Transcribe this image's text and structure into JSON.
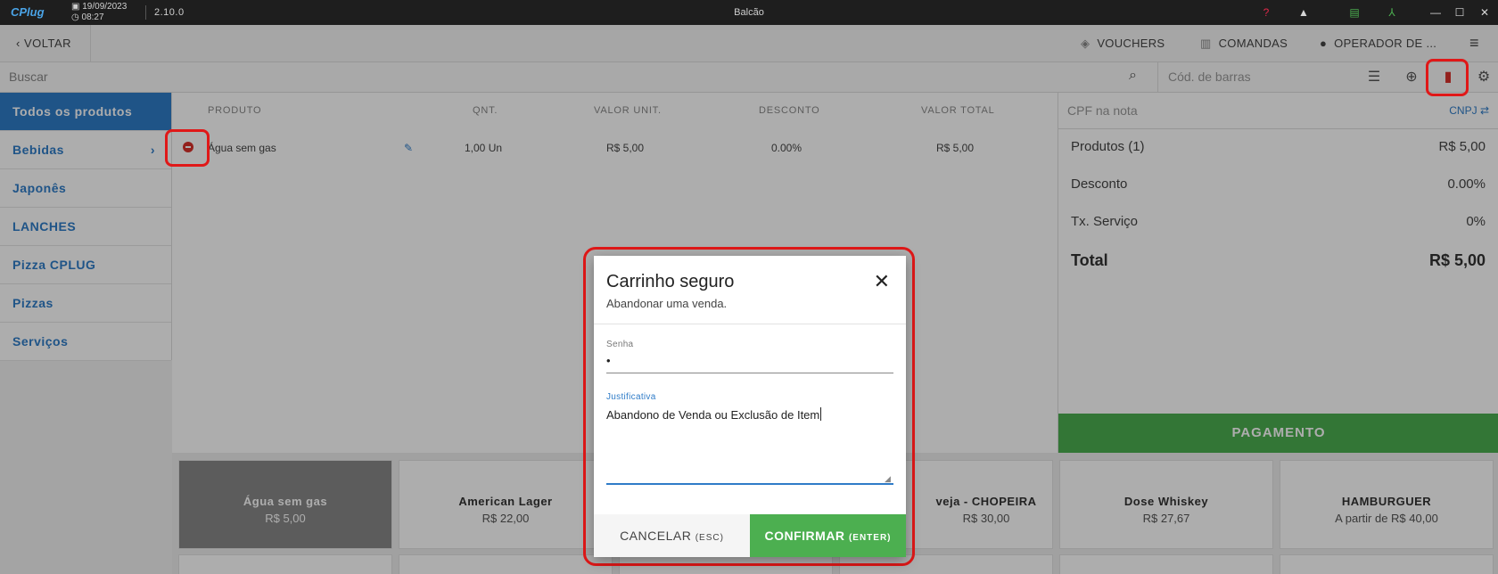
{
  "titlebar": {
    "logo": "CPlug",
    "date": "19/09/2023",
    "time": "08:27",
    "version": "2.10.0",
    "title": "Balcão",
    "icons": [
      "help-icon",
      "bell-icon",
      "server-icon",
      "network-icon",
      "minimize-icon",
      "maximize-icon",
      "close-icon"
    ]
  },
  "toolbar": {
    "back_label": "VOLTAR",
    "vouchers_label": "VOUCHERS",
    "comandas_label": "COMANDAS",
    "operador_label": "OPERADOR DE ..."
  },
  "search": {
    "placeholder": "Buscar",
    "barcode_placeholder": "Cód. de barras"
  },
  "sidebar": {
    "items": [
      {
        "label": "Todos os produtos",
        "active": true
      },
      {
        "label": "Bebidas",
        "has_children": true
      },
      {
        "label": "Japonês"
      },
      {
        "label": "LANCHES"
      },
      {
        "label": "Pizza CPLUG"
      },
      {
        "label": "Pizzas"
      },
      {
        "label": "Serviços"
      }
    ]
  },
  "table": {
    "headers": {
      "produto": "PRODUTO",
      "qnt": "QNT.",
      "valor_unit": "VALOR UNIT.",
      "desconto": "DESCONTO",
      "valor_total": "VALOR TOTAL"
    },
    "rows": [
      {
        "produto": "Água sem gas",
        "qnt": "1,00 Un",
        "valor_unit": "R$ 5,00",
        "desconto": "0.00%",
        "valor_total": "R$ 5,00"
      }
    ]
  },
  "summary": {
    "cpf_placeholder": "CPF na nota",
    "cnpj_label": "CNPJ",
    "produtos_label": "Produtos (1)",
    "produtos_value": "R$ 5,00",
    "desconto_label": "Desconto",
    "desconto_value": "0.00%",
    "servico_label": "Tx. Serviço",
    "servico_value": "0%",
    "total_label": "Total",
    "total_value": "R$ 5,00",
    "pay_label": "PAGAMENTO"
  },
  "products": [
    {
      "name": "Água sem gas",
      "price": "R$ 5,00",
      "selected": true
    },
    {
      "name": "American Lager",
      "price": "R$ 22,00"
    },
    {
      "name": "",
      "price": ""
    },
    {
      "name": "veja - CHOPEIRA",
      "price": "R$ 30,00"
    },
    {
      "name": "Dose Whiskey",
      "price": "R$ 27,67"
    },
    {
      "name": "HAMBURGUER",
      "price": "A partir de R$ 40,00"
    }
  ],
  "dialog": {
    "title": "Carrinho seguro",
    "subtitle": "Abandonar uma venda.",
    "senha_label": "Senha",
    "senha_value": "•",
    "justificativa_label": "Justificativa",
    "justificativa_value": "Abandono de Venda ou Exclusão de Item",
    "cancel_label": "CANCELAR",
    "cancel_key": "(ESC)",
    "confirm_label": "CONFIRMAR",
    "confirm_key": "(ENTER)"
  },
  "colors": {
    "accent": "#2f7cc8",
    "success": "#4caf50",
    "danger": "#e01818",
    "titlebar": "#1e1e1e"
  }
}
